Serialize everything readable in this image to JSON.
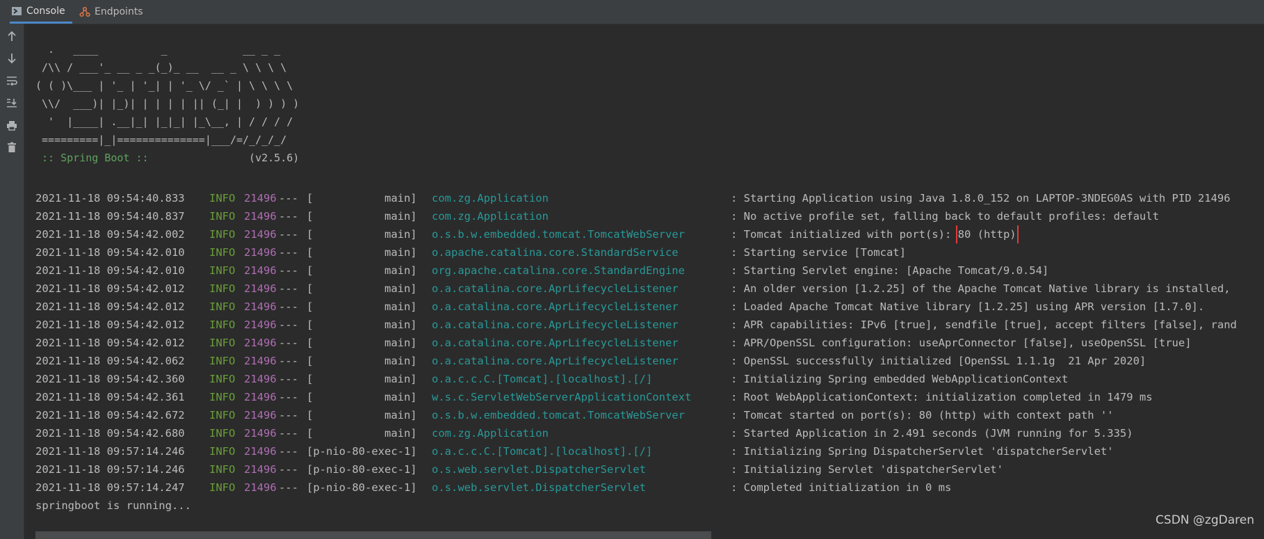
{
  "tabs": [
    {
      "label": "Console",
      "icon": "console-icon",
      "active": true
    },
    {
      "label": "Endpoints",
      "icon": "endpoints-icon",
      "active": false
    }
  ],
  "gutter_buttons": [
    {
      "name": "scroll-up-icon",
      "glyph": "↑"
    },
    {
      "name": "scroll-down-icon",
      "glyph": "↓"
    },
    {
      "name": "soft-wrap-icon",
      "glyph": "≡"
    },
    {
      "name": "scroll-to-end-icon",
      "glyph": "⤓"
    },
    {
      "name": "print-icon",
      "glyph": "⎙"
    },
    {
      "name": "clear-all-icon",
      "glyph": "🗑"
    }
  ],
  "banner": {
    "lines": [
      "  .   ____          _            __ _ _",
      " /\\\\ / ___'_ __ _ _(_)_ __  __ _ \\ \\ \\ \\",
      "( ( )\\___ | '_ | '_| | '_ \\/ _` | \\ \\ \\ \\",
      " \\\\/  ___)| |_)| | | | | || (_| |  ) ) ) )",
      "  '  |____| .__|_| |_|_| |_\\__, | / / / /",
      " =========|_|==============|___/=/_/_/_/"
    ],
    "spring_label": " :: Spring Boot :: ",
    "version": "               (v2.5.6)"
  },
  "logs": [
    {
      "ts": "2021-11-18 09:54:40.833",
      "level": "INFO",
      "pid": "21496",
      "sep": "---",
      "thread": "[           main]",
      "logger": "com.zg.Application",
      "msg": ": Starting Application using Java 1.8.0_152 on LAPTOP-3NDEG0AS with PID 21496"
    },
    {
      "ts": "2021-11-18 09:54:40.837",
      "level": "INFO",
      "pid": "21496",
      "sep": "---",
      "thread": "[           main]",
      "logger": "com.zg.Application",
      "msg": ": No active profile set, falling back to default profiles: default"
    },
    {
      "ts": "2021-11-18 09:54:42.002",
      "level": "INFO",
      "pid": "21496",
      "sep": "---",
      "thread": "[           main]",
      "logger": "o.s.b.w.embedded.tomcat.TomcatWebServer",
      "msg": ": Tomcat initialized with port(s): ",
      "highlight": "80 (http)"
    },
    {
      "ts": "2021-11-18 09:54:42.010",
      "level": "INFO",
      "pid": "21496",
      "sep": "---",
      "thread": "[           main]",
      "logger": "o.apache.catalina.core.StandardService",
      "msg": ": Starting service [Tomcat]"
    },
    {
      "ts": "2021-11-18 09:54:42.010",
      "level": "INFO",
      "pid": "21496",
      "sep": "---",
      "thread": "[           main]",
      "logger": "org.apache.catalina.core.StandardEngine",
      "msg": ": Starting Servlet engine: [Apache Tomcat/9.0.54]"
    },
    {
      "ts": "2021-11-18 09:54:42.012",
      "level": "INFO",
      "pid": "21496",
      "sep": "---",
      "thread": "[           main]",
      "logger": "o.a.catalina.core.AprLifecycleListener",
      "msg": ": An older version [1.2.25] of the Apache Tomcat Native library is installed,"
    },
    {
      "ts": "2021-11-18 09:54:42.012",
      "level": "INFO",
      "pid": "21496",
      "sep": "---",
      "thread": "[           main]",
      "logger": "o.a.catalina.core.AprLifecycleListener",
      "msg": ": Loaded Apache Tomcat Native library [1.2.25] using APR version [1.7.0]."
    },
    {
      "ts": "2021-11-18 09:54:42.012",
      "level": "INFO",
      "pid": "21496",
      "sep": "---",
      "thread": "[           main]",
      "logger": "o.a.catalina.core.AprLifecycleListener",
      "msg": ": APR capabilities: IPv6 [true], sendfile [true], accept filters [false], rand"
    },
    {
      "ts": "2021-11-18 09:54:42.012",
      "level": "INFO",
      "pid": "21496",
      "sep": "---",
      "thread": "[           main]",
      "logger": "o.a.catalina.core.AprLifecycleListener",
      "msg": ": APR/OpenSSL configuration: useAprConnector [false], useOpenSSL [true]"
    },
    {
      "ts": "2021-11-18 09:54:42.062",
      "level": "INFO",
      "pid": "21496",
      "sep": "---",
      "thread": "[           main]",
      "logger": "o.a.catalina.core.AprLifecycleListener",
      "msg": ": OpenSSL successfully initialized [OpenSSL 1.1.1g  21 Apr 2020]"
    },
    {
      "ts": "2021-11-18 09:54:42.360",
      "level": "INFO",
      "pid": "21496",
      "sep": "---",
      "thread": "[           main]",
      "logger": "o.a.c.c.C.[Tomcat].[localhost].[/]",
      "msg": ": Initializing Spring embedded WebApplicationContext"
    },
    {
      "ts": "2021-11-18 09:54:42.361",
      "level": "INFO",
      "pid": "21496",
      "sep": "---",
      "thread": "[           main]",
      "logger": "w.s.c.ServletWebServerApplicationContext",
      "msg": ": Root WebApplicationContext: initialization completed in 1479 ms"
    },
    {
      "ts": "2021-11-18 09:54:42.672",
      "level": "INFO",
      "pid": "21496",
      "sep": "---",
      "thread": "[           main]",
      "logger": "o.s.b.w.embedded.tomcat.TomcatWebServer",
      "msg": ": Tomcat started on port(s): 80 (http) with context path ''"
    },
    {
      "ts": "2021-11-18 09:54:42.680",
      "level": "INFO",
      "pid": "21496",
      "sep": "---",
      "thread": "[           main]",
      "logger": "com.zg.Application",
      "msg": ": Started Application in 2.491 seconds (JVM running for 5.335)"
    },
    {
      "ts": "2021-11-18 09:57:14.246",
      "level": "INFO",
      "pid": "21496",
      "sep": "---",
      "thread": "[p-nio-80-exec-1]",
      "logger": "o.a.c.c.C.[Tomcat].[localhost].[/]",
      "msg": ": Initializing Spring DispatcherServlet 'dispatcherServlet'"
    },
    {
      "ts": "2021-11-18 09:57:14.246",
      "level": "INFO",
      "pid": "21496",
      "sep": "---",
      "thread": "[p-nio-80-exec-1]",
      "logger": "o.s.web.servlet.DispatcherServlet",
      "msg": ": Initializing Servlet 'dispatcherServlet'"
    },
    {
      "ts": "2021-11-18 09:57:14.247",
      "level": "INFO",
      "pid": "21496",
      "sep": "---",
      "thread": "[p-nio-80-exec-1]",
      "logger": "o.s.web.servlet.DispatcherServlet",
      "msg": ": Completed initialization in 0 ms"
    }
  ],
  "final_line": "springboot is running...",
  "watermark": "CSDN @zgDaren",
  "colors": {
    "level": "#6a9e3a",
    "pid": "#b06eb4",
    "logger": "#299999",
    "highlight_border": "#e23c3c"
  }
}
